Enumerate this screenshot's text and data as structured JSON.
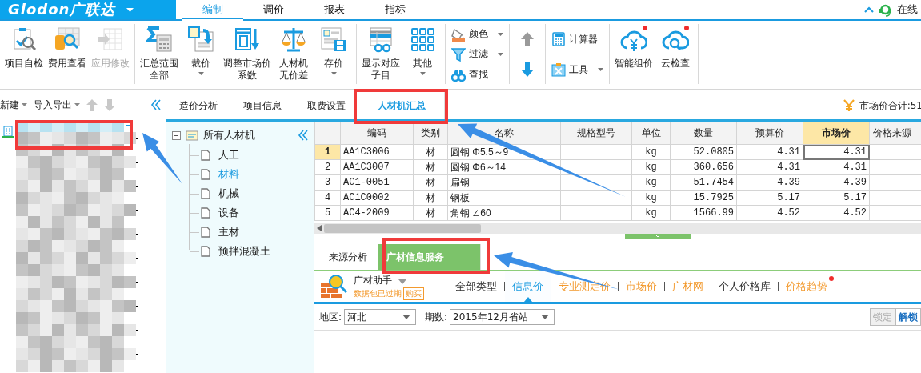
{
  "app": {
    "logo": "Glodon广联达",
    "menu_tabs": [
      {
        "label": "编制",
        "selected": true
      },
      {
        "label": "调价",
        "selected": false
      },
      {
        "label": "报表",
        "selected": false
      },
      {
        "label": "指标",
        "selected": false
      }
    ],
    "online": "在线"
  },
  "ribbon": {
    "groups": [
      {
        "items": [
          {
            "kind": "large",
            "label": "项目自检",
            "disabled": false,
            "dropdown": false,
            "badge": false
          },
          {
            "kind": "large",
            "label": "费用查看",
            "disabled": false,
            "dropdown": false,
            "badge": false
          },
          {
            "kind": "large",
            "label": "应用修改",
            "disabled": true,
            "dropdown": false,
            "badge": false
          }
        ]
      },
      {
        "items": [
          {
            "kind": "large",
            "label_lines": [
              "汇总范围",
              "全部"
            ],
            "disabled": false,
            "dropdown": false,
            "badge": false
          },
          {
            "kind": "large",
            "label": "裁价",
            "disabled": false,
            "dropdown": true,
            "badge": false
          },
          {
            "kind": "large",
            "label_lines": [
              "调整市场价",
              "系数"
            ],
            "disabled": false,
            "dropdown": false,
            "badge": false
          },
          {
            "kind": "large",
            "label_lines": [
              "人材机",
              "无价差"
            ],
            "disabled": false,
            "dropdown": false,
            "badge": false
          },
          {
            "kind": "large",
            "label": "存价",
            "disabled": false,
            "dropdown": true,
            "badge": false
          }
        ]
      },
      {
        "items": [
          {
            "kind": "large",
            "label_lines": [
              "显示对应",
              "子目"
            ],
            "disabled": false,
            "dropdown": false,
            "badge": false
          },
          {
            "kind": "large",
            "label": "其他",
            "disabled": false,
            "dropdown": true,
            "badge": false
          }
        ]
      },
      {
        "items": [
          {
            "kind": "small",
            "label": "颜色",
            "disabled": false,
            "dropdown": true
          },
          {
            "kind": "small",
            "label": "过滤",
            "disabled": false,
            "dropdown": true
          },
          {
            "kind": "small",
            "label": "查找",
            "disabled": false,
            "dropdown": false
          }
        ]
      },
      {
        "items": [
          {
            "kind": "arrow_up",
            "disabled": true
          },
          {
            "kind": "arrow_down",
            "disabled": false
          }
        ]
      },
      {
        "items": [
          {
            "kind": "small",
            "label": "计算器",
            "disabled": false,
            "dropdown": false
          },
          {
            "kind": "small",
            "label": "工具",
            "disabled": false,
            "dropdown": true
          }
        ]
      },
      {
        "items": [
          {
            "kind": "large",
            "label": "智能组价",
            "disabled": false,
            "dropdown": false,
            "badge": true
          },
          {
            "kind": "large",
            "label": "云检查",
            "disabled": false,
            "dropdown": false,
            "badge": true
          }
        ]
      }
    ]
  },
  "project_panel": {
    "toolbar": [
      {
        "kind": "menu",
        "label": "新建"
      },
      {
        "kind": "menu",
        "label": "导入导出"
      },
      {
        "kind": "move_up",
        "disabled": true
      },
      {
        "kind": "move_down",
        "disabled": true
      }
    ]
  },
  "view_tabs": [
    {
      "label": "造价分析",
      "selected": false
    },
    {
      "label": "项目信息",
      "selected": false
    },
    {
      "label": "取费设置",
      "selected": false
    },
    {
      "label": "人材机汇总",
      "selected": true
    }
  ],
  "market_total": "市场价合计:51",
  "category_tree": {
    "label": "所有人材机",
    "expanded": true,
    "selected": false,
    "children": [
      {
        "label": "人工",
        "selected": false
      },
      {
        "label": "材料",
        "selected": true
      },
      {
        "label": "机械",
        "selected": false
      },
      {
        "label": "设备",
        "selected": false
      },
      {
        "label": "主材",
        "selected": false
      },
      {
        "label": "预拌混凝土",
        "selected": false
      }
    ]
  },
  "table": {
    "columns": [
      {
        "label": "编码",
        "selected": false
      },
      {
        "label": "类别",
        "selected": false
      },
      {
        "label": "名称",
        "selected": false
      },
      {
        "label": "规格型号",
        "selected": false
      },
      {
        "label": "单位",
        "selected": false
      },
      {
        "label": "数量",
        "selected": false
      },
      {
        "label": "预算价",
        "selected": false
      },
      {
        "label": "市场价",
        "selected": true
      },
      {
        "label": "价格来源",
        "selected": false
      }
    ],
    "rows": [
      {
        "number": "1",
        "selected": true,
        "cells": [
          "AA1C3006",
          "材",
          "圆钢 Φ5.5～9",
          null,
          "kg",
          "52.0805",
          "4.31",
          "4.31",
          null
        ]
      },
      {
        "number": "2",
        "selected": false,
        "cells": [
          "AA1C3007",
          "材",
          "圆钢 Φ6～14",
          null,
          "kg",
          "360.656",
          "4.31",
          "4.31",
          null
        ]
      },
      {
        "number": "3",
        "selected": false,
        "cells": [
          "AC1-0051",
          "材",
          "扁钢",
          null,
          "kg",
          "51.7454",
          "4.39",
          "4.39",
          null
        ]
      },
      {
        "number": "4",
        "selected": false,
        "cells": [
          "AC1C0002",
          "材",
          "钢板",
          null,
          "kg",
          "15.7925",
          "5.17",
          "5.17",
          null
        ]
      },
      {
        "number": "5",
        "selected": false,
        "cells": [
          "AC4-2009",
          "材",
          "角钢 ∠60",
          null,
          "kg",
          "1566.99",
          "4.52",
          "4.52",
          null
        ]
      }
    ]
  },
  "info_panel": {
    "tabs": [
      {
        "label": "来源分析",
        "selected": false
      },
      {
        "label": "广材信息服务",
        "selected": true
      }
    ],
    "assistant": {
      "label": "广材助手",
      "status": "数据包已过期",
      "buy": "购买"
    },
    "price_types": [
      {
        "label": "全部类型",
        "color": "#333333",
        "selected": false,
        "badge": false
      },
      {
        "label": "信息价",
        "color": "#1a9be0",
        "selected": true,
        "badge": false
      },
      {
        "label": "专业测定价",
        "color": "#f39a2e",
        "selected": false,
        "badge": false
      },
      {
        "label": "市场价",
        "color": "#f39a2e",
        "selected": false,
        "badge": false
      },
      {
        "label": "广材网",
        "color": "#f39a2e",
        "selected": false,
        "badge": false
      },
      {
        "label": "个人价格库",
        "color": "#333333",
        "selected": false,
        "badge": false
      },
      {
        "label": "价格趋势",
        "color": "#f39a2e",
        "selected": false,
        "badge": true
      }
    ],
    "filters": [
      {
        "label": "地区:",
        "value": "河北"
      },
      {
        "label": "期数:",
        "value": "2015年12月省站"
      }
    ],
    "buttons": [
      {
        "label": "锁定",
        "disabled": true
      },
      {
        "label": "解锁",
        "disabled": false
      }
    ]
  }
}
